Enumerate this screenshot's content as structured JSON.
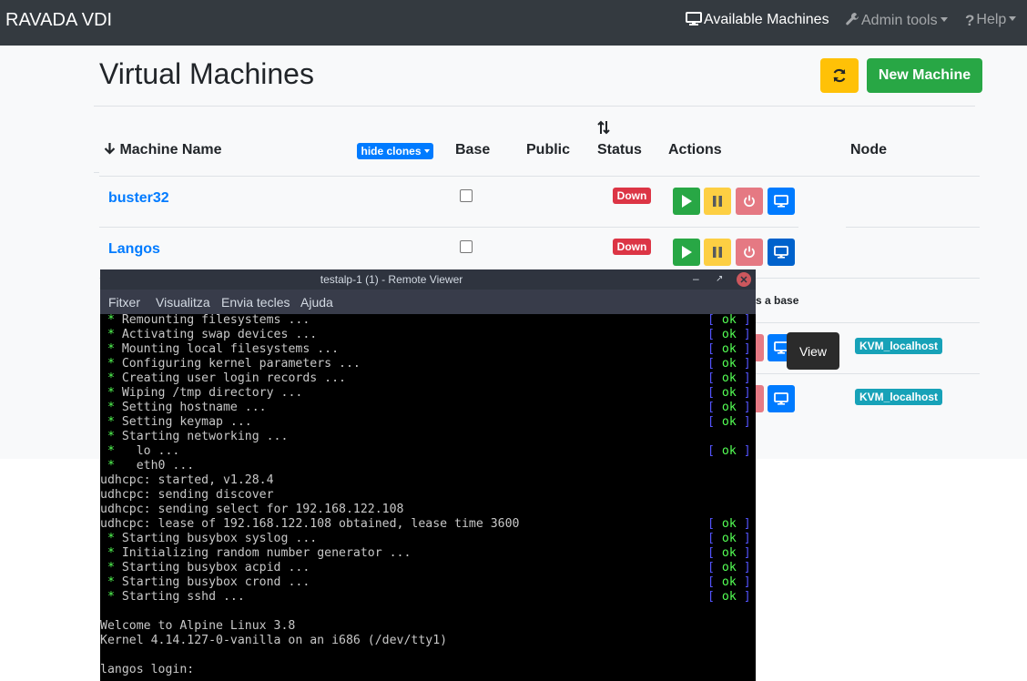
{
  "navbar": {
    "brand": "RAVADA VDI",
    "available": "Available Machines",
    "admin": "Admin tools",
    "help": "Help"
  },
  "page": {
    "title": "Virtual Machines",
    "new_machine": "New Machine"
  },
  "table": {
    "headers": {
      "name": "Machine Name",
      "base": "Base",
      "public": "Public",
      "status": "Status",
      "actions": "Actions",
      "node": "Node"
    },
    "hide_clones": "hide clones",
    "rows": [
      {
        "name": "buster32",
        "status": "Down",
        "node": ""
      },
      {
        "name": "Langos",
        "status": "Down",
        "node": ""
      },
      {
        "partial": "s a base"
      },
      {
        "node": "KVM_localhost"
      },
      {
        "node": "KVM_localhost"
      }
    ]
  },
  "tooltip": "View",
  "viewer": {
    "title": "testalp-1 (1) - Remote Viewer",
    "menu": [
      "Fitxer",
      "Visualitza",
      "Envia tecles",
      "Ajuda"
    ],
    "terminal": [
      {
        "text": " * Remounting filesystems ...",
        "ok": true
      },
      {
        "text": " * Activating swap devices ...",
        "ok": true
      },
      {
        "text": " * Mounting local filesystems ...",
        "ok": true
      },
      {
        "text": " * Configuring kernel parameters ...",
        "ok": true
      },
      {
        "text": " * Creating user login records ...",
        "ok": true
      },
      {
        "text": " * Wiping /tmp directory ...",
        "ok": true
      },
      {
        "text": " * Setting hostname ...",
        "ok": true
      },
      {
        "text": " * Setting keymap ...",
        "ok": true
      },
      {
        "text": " * Starting networking ...",
        "ok": false
      },
      {
        "text": " *   lo ...",
        "ok": true
      },
      {
        "text": " *   eth0 ...",
        "ok": false
      },
      {
        "text": "udhcpc: started, v1.28.4",
        "ok": false
      },
      {
        "text": "udhcpc: sending discover",
        "ok": false
      },
      {
        "text": "udhcpc: sending select for 192.168.122.108",
        "ok": false
      },
      {
        "text": "udhcpc: lease of 192.168.122.108 obtained, lease time 3600",
        "ok": true
      },
      {
        "text": " * Starting busybox syslog ...",
        "ok": true
      },
      {
        "text": " * Initializing random number generator ...",
        "ok": true
      },
      {
        "text": " * Starting busybox acpid ...",
        "ok": true
      },
      {
        "text": " * Starting busybox crond ...",
        "ok": true
      },
      {
        "text": " * Starting sshd ...",
        "ok": true
      },
      {
        "text": "",
        "ok": false
      },
      {
        "text": "Welcome to Alpine Linux 3.8",
        "ok": false
      },
      {
        "text": "Kernel 4.14.127-0-vanilla on an i686 (/dev/tty1)",
        "ok": false
      },
      {
        "text": "",
        "ok": false
      },
      {
        "text": "langos login:",
        "ok": false
      }
    ],
    "ok_text": "[ ok ]"
  }
}
